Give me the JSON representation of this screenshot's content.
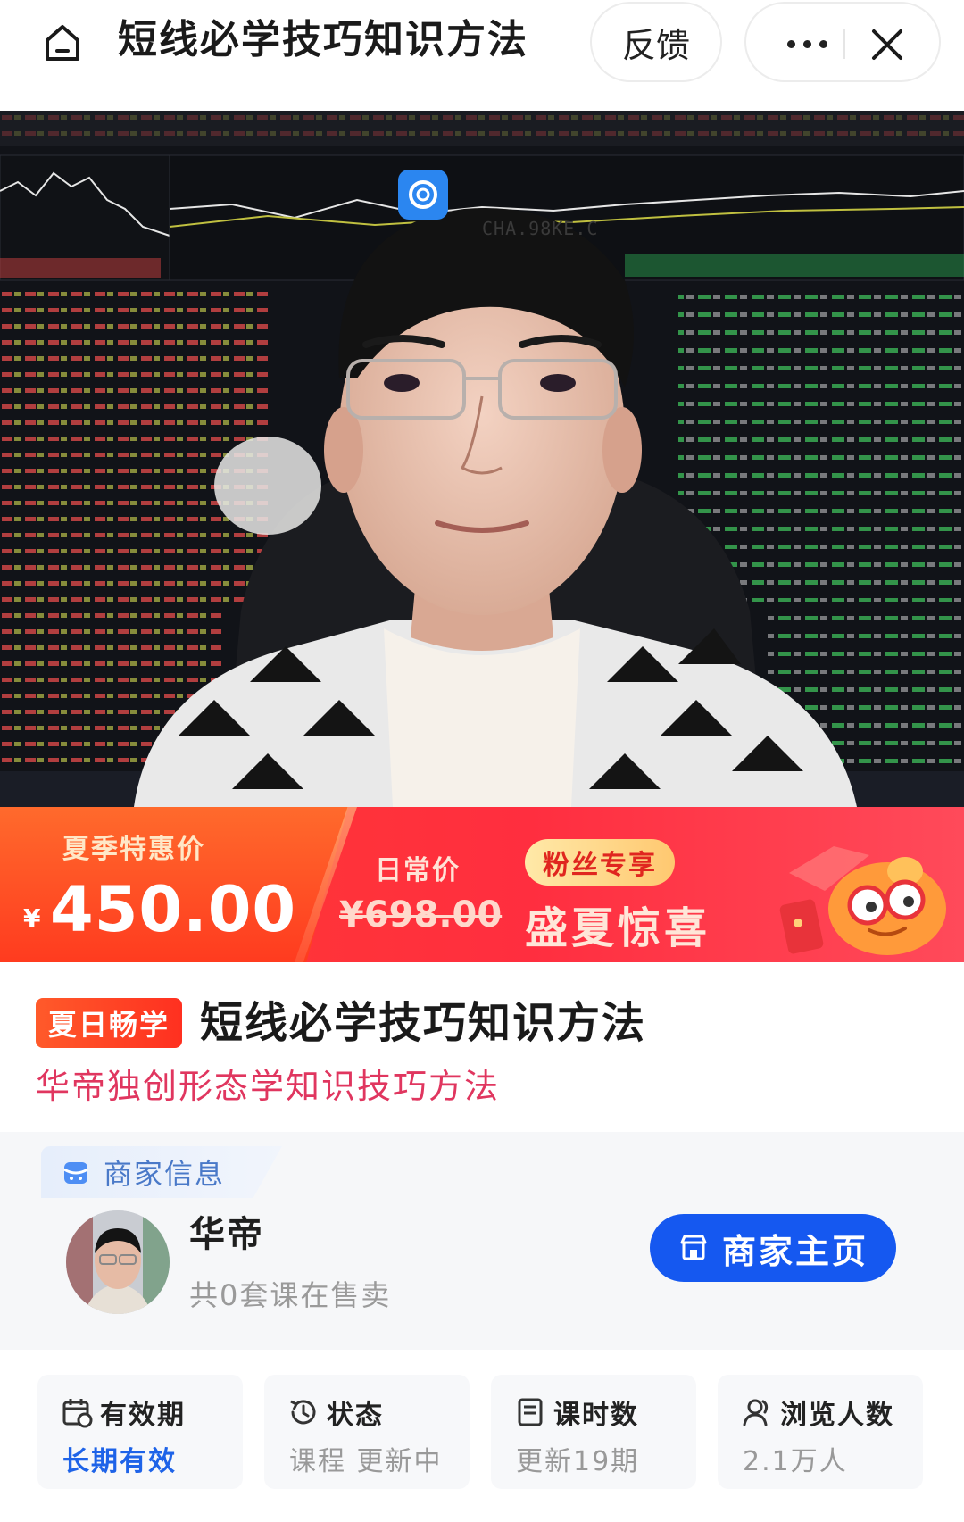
{
  "topbar": {
    "title": "短线必学技巧知识方法",
    "feedback_label": "反馈"
  },
  "hero": {
    "watermark_text": "CHA.98KE.C"
  },
  "price": {
    "promo_label": "夏季特惠价",
    "currency": "¥",
    "value": "450.00",
    "regular_label": "日常价",
    "regular_price": "¥698.00",
    "fans_tag": "粉丝专享",
    "campaign_text": "盛夏惊喜"
  },
  "course": {
    "badge": "夏日畅学",
    "title": "短线必学技巧知识方法",
    "subtitle": "华帝独创形态学知识技巧方法"
  },
  "merchant": {
    "section_label": "商家信息",
    "name": "华帝",
    "course_count": "共0套课在售卖",
    "home_button": "商家主页"
  },
  "info_cards": [
    {
      "label": "有效期",
      "value": "长期有效",
      "icon": "calendar-icon"
    },
    {
      "label": "状态",
      "value": "课程 更新中",
      "icon": "history-clock-icon"
    },
    {
      "label": "课时数",
      "value": "更新19期",
      "icon": "document-icon"
    },
    {
      "label": "浏览人数",
      "value": "2.1万人",
      "icon": "user-icon"
    }
  ],
  "colors": {
    "accent_blue": "#1558f0",
    "price_red": "#ff3b30",
    "subtitle_pink": "#e0365f"
  }
}
